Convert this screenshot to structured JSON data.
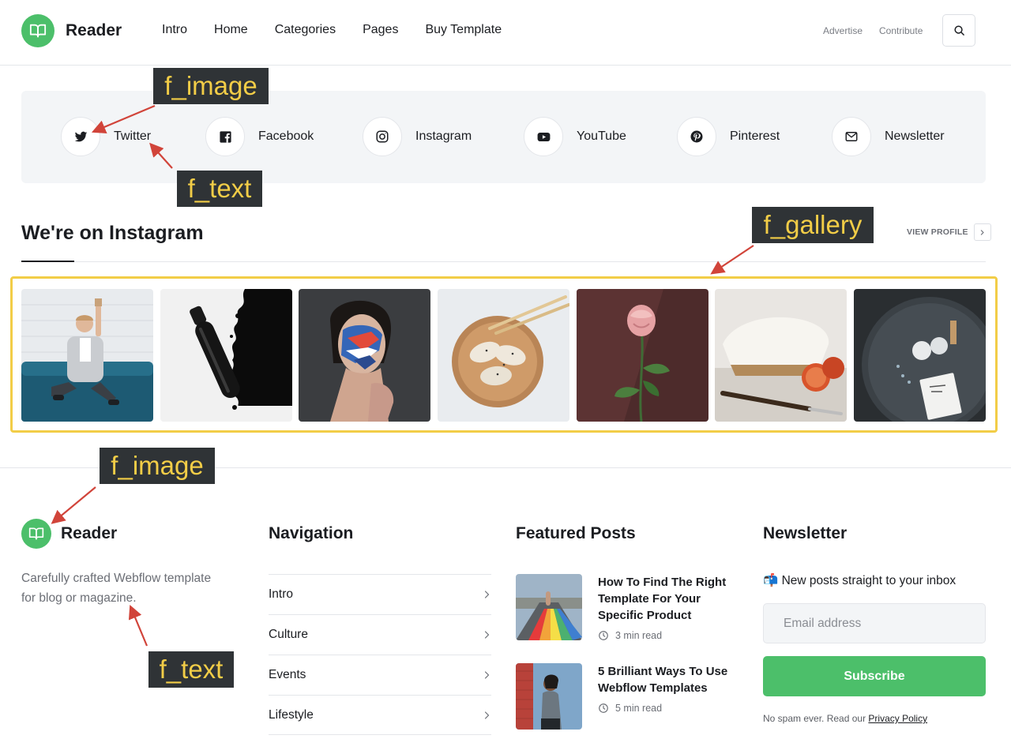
{
  "header": {
    "brand": "Reader",
    "nav": [
      "Intro",
      "Home",
      "Categories",
      "Pages",
      "Buy Template"
    ],
    "right_links": [
      "Advertise",
      "Contribute"
    ]
  },
  "social": [
    {
      "label": "Twitter",
      "icon": "twitter-icon"
    },
    {
      "label": "Facebook",
      "icon": "facebook-icon"
    },
    {
      "label": "Instagram",
      "icon": "instagram-icon"
    },
    {
      "label": "YouTube",
      "icon": "youtube-icon"
    },
    {
      "label": "Pinterest",
      "icon": "pinterest-icon"
    },
    {
      "label": "Newsletter",
      "icon": "envelope-icon"
    }
  ],
  "instagram": {
    "title": "We're on Instagram",
    "view_profile": "VIEW PROFILE",
    "photos": [
      "man-on-sofa-photo",
      "black-brush-photo",
      "face-paint-portrait-photo",
      "dumplings-bowl-photo",
      "pink-rose-photo",
      "cake-and-orange-photo",
      "dark-tray-photo"
    ]
  },
  "footer": {
    "brand": "Reader",
    "tagline": "Carefully crafted Webflow template for blog or magazine.",
    "navigation": {
      "title": "Navigation",
      "items": [
        "Intro",
        "Culture",
        "Events",
        "Lifestyle"
      ]
    },
    "featured": {
      "title": "Featured Posts",
      "posts": [
        {
          "title": "How To Find The Right Template For Your Specific Product",
          "read_time": "3 min read"
        },
        {
          "title": "5 Brilliant Ways To Use Webflow Templates",
          "read_time": "5 min read"
        }
      ]
    },
    "newsletter": {
      "title": "Newsletter",
      "text": "📬 New posts straight to your inbox",
      "placeholder": "Email address",
      "button": "Subscribe",
      "note": "No spam ever. Read our ",
      "policy_link": "Privacy Policy"
    }
  },
  "annotations": [
    "f_image",
    "f_text",
    "f_gallery",
    "f_image",
    "f_text"
  ],
  "colors": {
    "accent": "#4cbf6a",
    "annotation_highlight": "#f2cd47",
    "annotation_bg": "#2f3336"
  }
}
